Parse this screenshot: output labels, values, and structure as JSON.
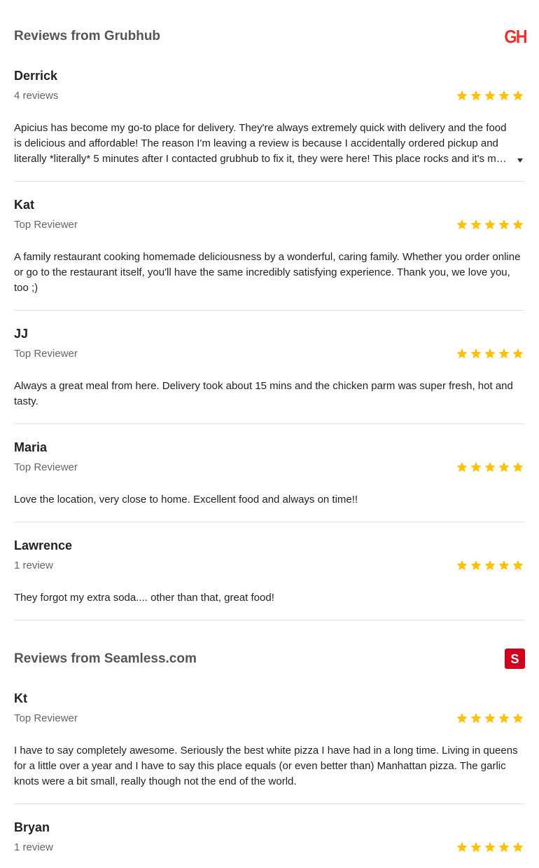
{
  "sections": [
    {
      "title": "Reviews from Grubhub",
      "logo_text": "GH",
      "logo_color": "#e8322c",
      "reviews": [
        {
          "name": "Derrick",
          "meta": "4 reviews",
          "rating": 5,
          "text": "Apicius has become my go-to place for delivery. They're always extremely quick with delivery and the food is delicious and affordable! The reason I'm leaving a review is because I accidentally ordered pickup and literally *literally* 5 minutes after I contacted grubhub to fix it, they were here! This place rocks and it's my favorite!"
        },
        {
          "name": "Kat",
          "meta": "Top Reviewer",
          "rating": 5,
          "text": "A family restaurant cooking homemade deliciousness by a wonderful, caring family. Whether you order online or go to the restaurant itself, you'll have the same incredibly satisfying experience. Thank you, we love you, too ;)"
        },
        {
          "name": "JJ",
          "meta": "Top Reviewer",
          "rating": 5,
          "text": "Always a great meal from here. Delivery took about 15 mins and the chicken parm was super fresh, hot and tasty."
        },
        {
          "name": "Maria",
          "meta": "Top Reviewer",
          "rating": 5,
          "text": "Love the location, very close to home. Excellent food and always on time!!"
        },
        {
          "name": "Lawrence",
          "meta": "1 review",
          "rating": 5,
          "text": "They forgot my extra soda.... other than that, great food!"
        }
      ]
    },
    {
      "title": "Reviews from Seamless.com",
      "logo_text": "S",
      "logo_color": "#d0021b",
      "reviews": [
        {
          "name": "Kt",
          "meta": "Top Reviewer",
          "rating": 5,
          "text": "I have to say completely awesome. Seriously the best white pizza I have had in a long time. Living in queens for a little over a year and I have to say this place equals (or even better than) Manhattan pizza. The garlic knots were a bit small, really though not the end of the world."
        },
        {
          "name": "Bryan",
          "meta": "1 review",
          "rating": 5,
          "text": ""
        }
      ]
    }
  ],
  "star_color": "#ffc107"
}
